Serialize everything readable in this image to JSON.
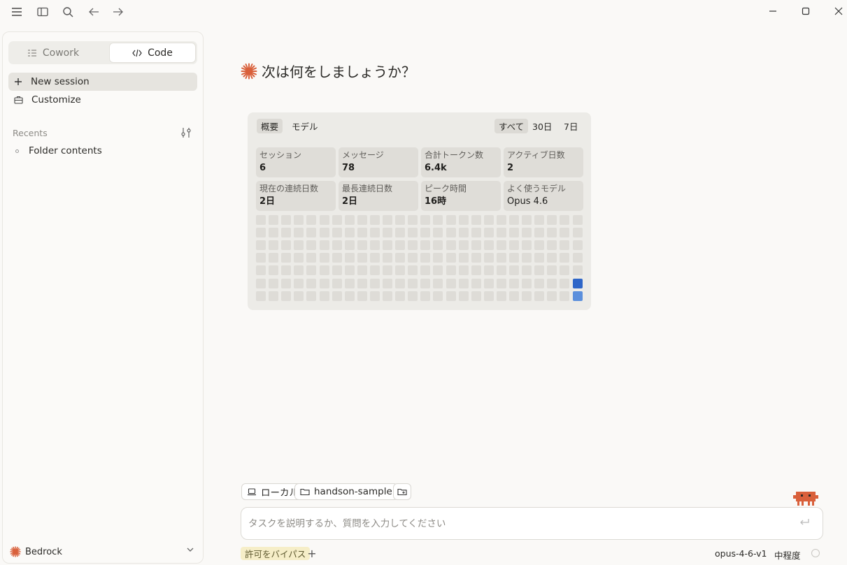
{
  "titlebar": {
    "icons": [
      "menu-icon",
      "sidebar-toggle-icon",
      "search-icon",
      "back-arrow-icon",
      "forward-arrow-icon"
    ],
    "window_controls": [
      "minimize-icon",
      "maximize-icon",
      "close-icon"
    ]
  },
  "sidebar": {
    "modes": [
      {
        "label": "Cowork",
        "icon": "cowork-icon",
        "active": false
      },
      {
        "label": "Code",
        "icon": "code-icon",
        "active": true
      }
    ],
    "new_session": "New session",
    "customize": "Customize",
    "recents_label": "Recents",
    "recents": [
      "Folder contents"
    ],
    "account": "Bedrock"
  },
  "main": {
    "heading": "次は何をしましょうか？",
    "stats": {
      "tabs": [
        "概要",
        "モデル"
      ],
      "ranges": [
        "すべて",
        "30日",
        "7日"
      ],
      "active_tab": "概要",
      "active_range": "すべて",
      "boxes": [
        {
          "label": "セッション",
          "value": "6"
        },
        {
          "label": "メッセージ",
          "value": "78"
        },
        {
          "label": "合計トークン数",
          "value": "6.4k"
        },
        {
          "label": "アクティブ日数",
          "value": "2"
        },
        {
          "label": "現在の連続日数",
          "value": "2日"
        },
        {
          "label": "最長連続日数",
          "value": "2日"
        },
        {
          "label": "ピーク時間",
          "value": "16時"
        },
        {
          "label": "よく使うモデル",
          "value": "Opus 4.6"
        }
      ],
      "heatmap": {
        "weeks": 26,
        "days": 7,
        "active_cells": [
          {
            "week": 25,
            "day": 5,
            "color": "#2f66c8"
          },
          {
            "week": 25,
            "day": 6,
            "color": "#5b8fdc"
          }
        ]
      }
    },
    "composer": {
      "chips": [
        "ローカル",
        "handson-sample"
      ],
      "placeholder": "タスクを説明するか、質問を入力してください",
      "bypass_label": "許可をバイパス",
      "plus": "+",
      "model": "opus-4-6-v1",
      "effort": "中程度"
    }
  },
  "colors": {
    "accent": "#d9603b",
    "heat_dark": "#2f66c8",
    "heat_light": "#5b8fdc",
    "heat_empty": "#dedcd7"
  }
}
